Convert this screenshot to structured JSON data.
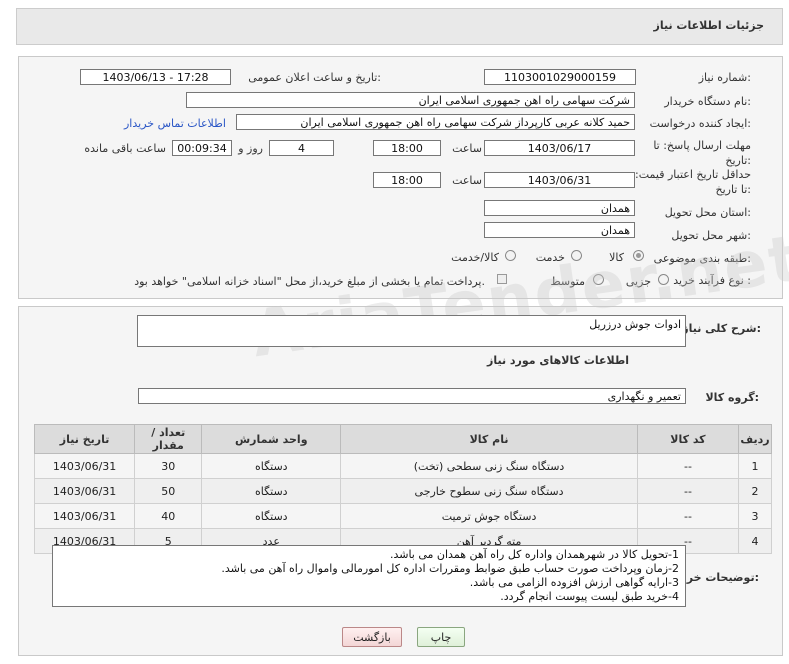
{
  "header": {
    "title": "جزئیات اطلاعات نیاز"
  },
  "form": {
    "need_number_label": "شماره نیاز:",
    "need_number": "1103001029000159",
    "announce_datetime_label": "تاریخ و ساعت اعلان عمومی:",
    "announce_datetime": "1403/06/13 - 17:28",
    "buyer_org_label": "نام دستگاه خریدار:",
    "buyer_org": "شرکت سهامی راه اهن جمهوری اسلامی ایران",
    "requester_label": "ایجاد کننده درخواست:",
    "requester": "حمید کلانه عربی کارپرداز شرکت سهامی راه اهن جمهوری اسلامی ایران",
    "buyer_contact_link": "اطلاعات تماس خریدار",
    "reply_deadline_label": "مهلت ارسال پاسخ: تا تاریخ:",
    "reply_date": "1403/06/17",
    "time_label": "ساعت",
    "reply_time": "18:00",
    "days_value": "4",
    "days_label": "روز و",
    "remaining_time": "00:09:34",
    "remaining_label": "ساعت باقی مانده",
    "price_validity_label": "حداقل تاریخ اعتبار قیمت: تا تاریخ:",
    "price_validity_date": "1403/06/31",
    "price_validity_time": "18:00",
    "province_label": "استان محل تحویل:",
    "province": "همدان",
    "city_label": "شهر محل تحویل:",
    "city": "همدان",
    "category_label": "طبقه بندی موضوعی:",
    "category_options": [
      "کالا",
      "خدمت",
      "کالا/خدمت"
    ],
    "category_selected": "کالا",
    "process_label": "نوع فرآیند خرید :",
    "process_options": [
      "جزیی",
      "متوسط"
    ],
    "payment_note": "پرداخت تمام یا بخشی از مبلغ خرید،از محل \"اسناد خزانه اسلامی\" خواهد بود."
  },
  "details": {
    "description_label": "شرح کلی نیاز:",
    "description": "ادوات جوش درزریل",
    "goods_info_title": "اطلاعات کالاهای مورد نیاز",
    "goods_group_label": "گروه کالا:",
    "goods_group": "تعمیر و نگهداری"
  },
  "table": {
    "headers": [
      "ردیف",
      "کد کالا",
      "نام کالا",
      "واحد شمارش",
      "تعداد / مقدار",
      "تاریخ نیاز"
    ],
    "rows": [
      [
        "1",
        "--",
        "دستگاه سنگ زنی سطحی (تخت)",
        "دستگاه",
        "30",
        "1403/06/31"
      ],
      [
        "2",
        "--",
        "دستگاه سنگ زنی سطوح خارجی",
        "دستگاه",
        "50",
        "1403/06/31"
      ],
      [
        "3",
        "--",
        "دستگاه جوش ترمیت",
        "دستگاه",
        "40",
        "1403/06/31"
      ],
      [
        "4",
        "--",
        "مته گردبر آهن",
        "عدد",
        "5",
        "1403/06/31"
      ]
    ]
  },
  "notes": {
    "label": "توضیحات خریدار:",
    "lines": [
      "1-تحویل کالا در شهرهمدان واداره کل راه آهن همدان می باشد.",
      "2-زمان وپرداخت صورت حساب طبق ضوابط ومقررات اداره کل امورمالی واموال راه آهن می باشد.",
      "3-ارایه گواهی ارزش افزوده الزامی می باشد.",
      "4-خرید طبق لیست پیوست انجام گردد."
    ]
  },
  "buttons": {
    "print": "چاپ",
    "back": "بازگشت"
  },
  "watermark": "AriaTender.net"
}
